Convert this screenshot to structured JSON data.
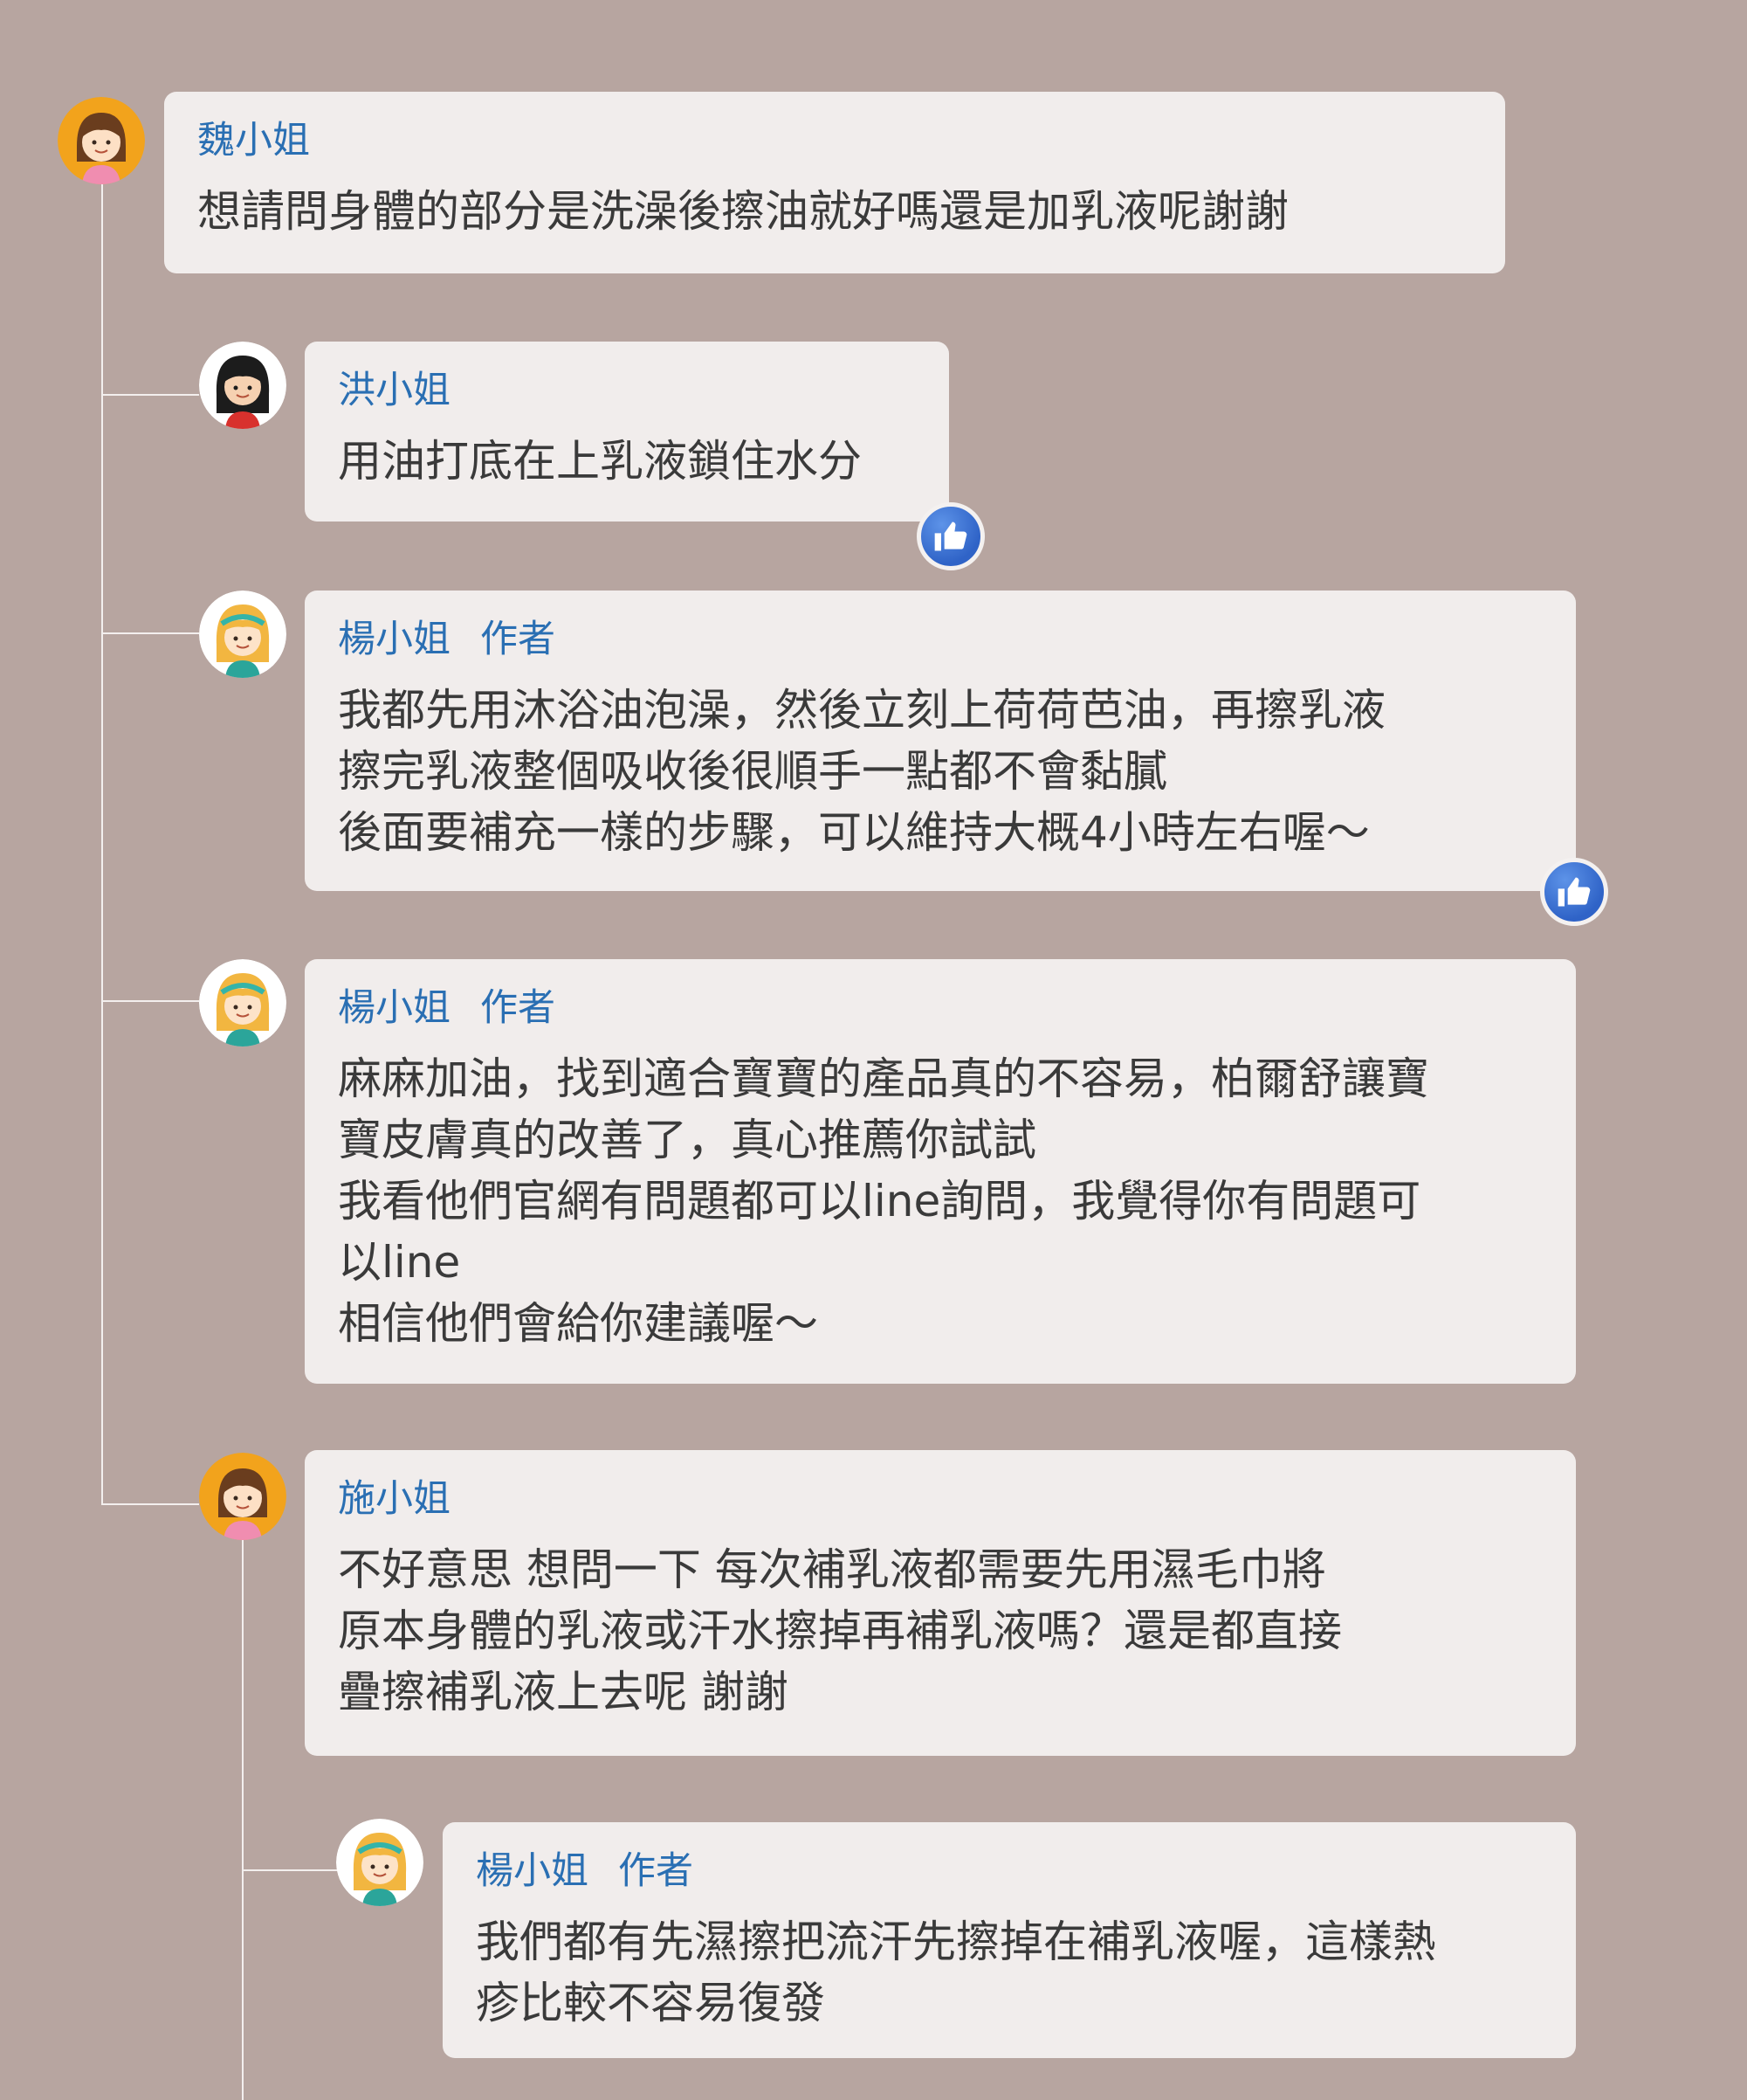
{
  "comments": [
    {
      "name": "魏小姐",
      "badge": "",
      "text": "想請問身體的部分是洗澡後擦油就好嗎還是加乳液呢謝謝",
      "avatar": "girl-brown-hair-avatar"
    },
    {
      "name": "洪小姐",
      "badge": "",
      "text": "用油打底在上乳液鎖住水分",
      "avatar": "girl-black-hair-avatar"
    },
    {
      "name": "楊小姐",
      "badge": "作者",
      "text": "我都先用沐浴油泡澡，然後立刻上荷荷芭油，再擦乳液\n擦完乳液整個吸收後很順手一點都不會黏膩\n後面要補充一樣的步驟，可以維持大概4小時左右喔～",
      "avatar": "girl-blonde-hair-avatar"
    },
    {
      "name": "楊小姐",
      "badge": "作者",
      "text": "麻麻加油，找到適合寶寶的產品真的不容易，柏爾舒讓寶\n寶皮膚真的改善了，真心推薦你試試\n我看他們官網有問題都可以line詢問，我覺得你有問題可\n以line\n相信他們會給你建議喔～",
      "avatar": "girl-blonde-hair-avatar"
    },
    {
      "name": "施小姐",
      "badge": "",
      "text": "不好意思 想問一下 每次補乳液都需要先用濕毛巾將\n原本身體的乳液或汗水擦掉再補乳液嗎？還是都直接\n疊擦補乳液上去呢 謝謝",
      "avatar": "girl-brown-hair-avatar"
    },
    {
      "name": "楊小姐",
      "badge": "作者",
      "text": "我們都有先濕擦把流汗先擦掉在補乳液喔，這樣熱\n疹比較不容易復發",
      "avatar": "girl-blonde-hair-avatar"
    }
  ],
  "colors": {
    "background": "#b7a5a0",
    "bubble": "#f1edec",
    "name": "#2a6fb3",
    "like": "#3d71d6"
  },
  "icons": {
    "like": "thumbs-up-icon"
  }
}
